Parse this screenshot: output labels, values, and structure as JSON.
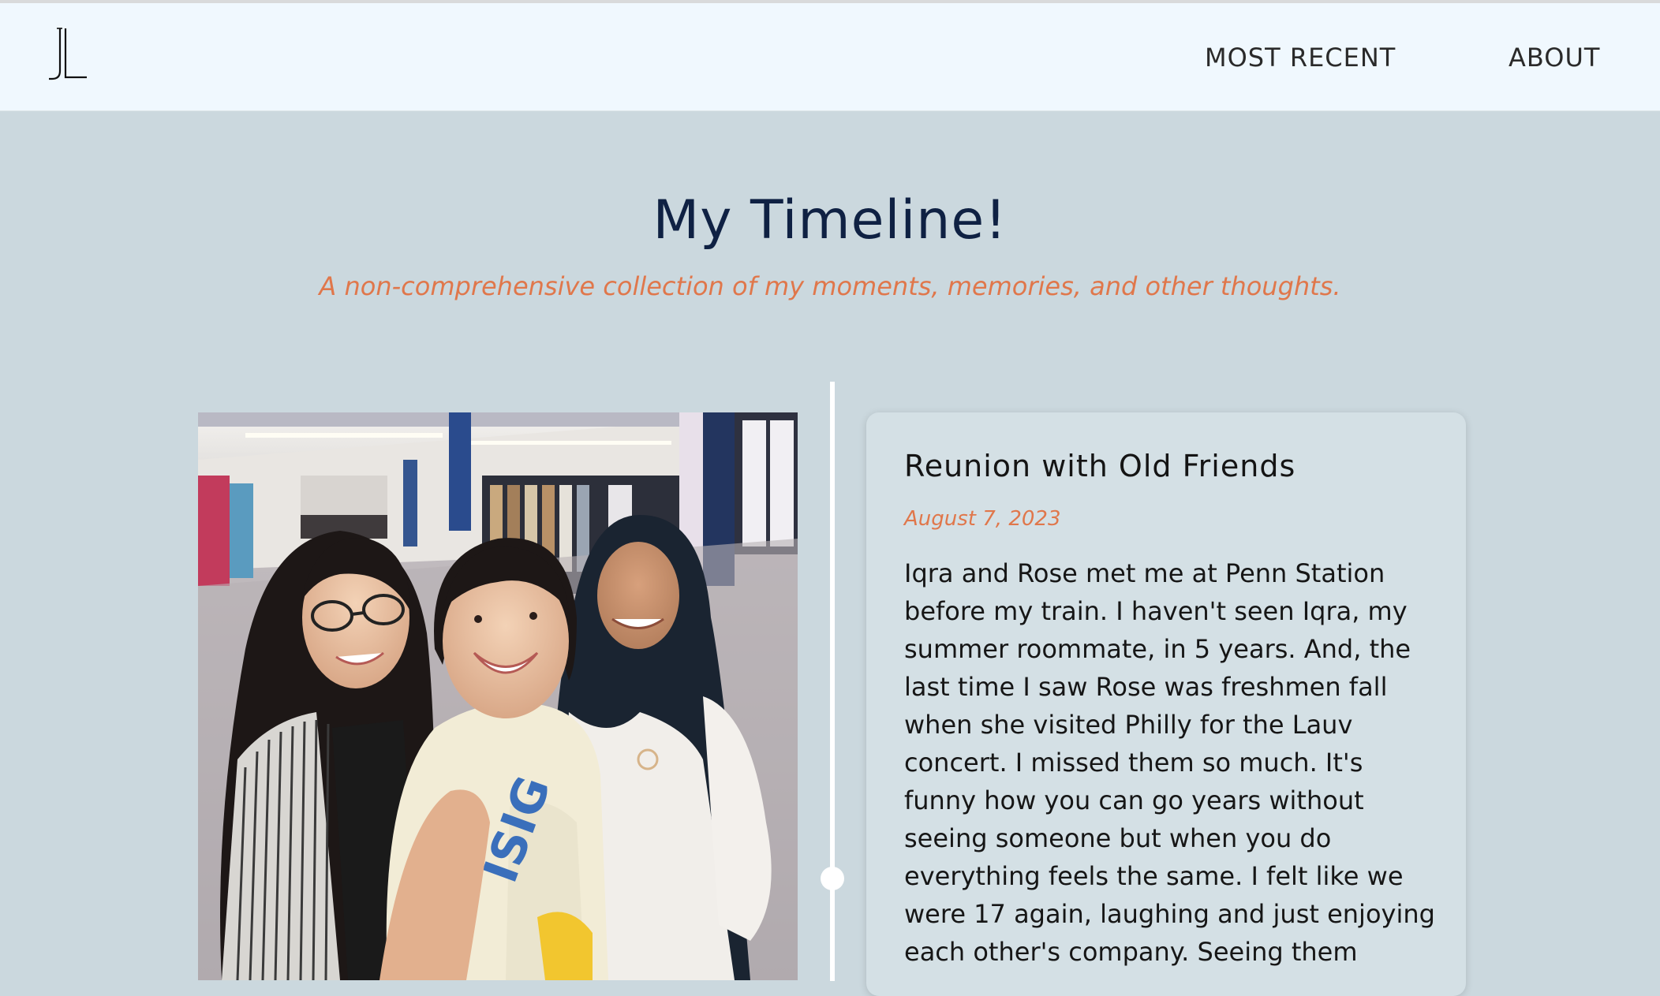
{
  "nav": {
    "logo_text": "JL",
    "links": [
      "MOST RECENT",
      "ABOUT"
    ]
  },
  "header": {
    "title": "My Timeline!",
    "subtitle": "A non-comprehensive collection of my moments, memories, and other thoughts."
  },
  "entry": {
    "title": "Reunion with Old Friends",
    "date": "August 7, 2023",
    "body": "Iqra and Rose met me at Penn Station before my train. I haven't seen Iqra, my summer roommate, in 5 years. And, the last time I saw Rose was freshmen fall when she visited Philly for the Lauv concert. I missed them so much. It's funny how you can go years without seeing someone but when you do everything feels the same. I felt like we were 17 again, laughing and just enjoying each other's company. Seeing them",
    "photo_icon": "group-selfie-photo"
  },
  "colors": {
    "page_bg": "#cbd8de",
    "nav_bg": "#f0f8fe",
    "title": "#0f2143",
    "accent": "#e0774b",
    "card_bg": "#d4e0e5",
    "timeline": "#ffffff"
  }
}
